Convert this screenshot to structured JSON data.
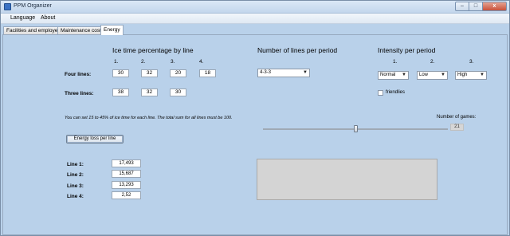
{
  "window": {
    "title": "PPM Organizer",
    "caption_buttons": {
      "minimize": "–",
      "maximize": "□",
      "close": "x"
    }
  },
  "menu": {
    "items": [
      {
        "label": "Language"
      },
      {
        "label": "About"
      }
    ]
  },
  "tabs": [
    {
      "label": "Facilities and employees",
      "active": false
    },
    {
      "label": "Maintenance costs",
      "active": false
    },
    {
      "label": "Energy",
      "active": true
    }
  ],
  "ice_time": {
    "heading": "Ice time percentage by line",
    "columns": [
      "1.",
      "2.",
      "3.",
      "4."
    ],
    "four_lines": {
      "label": "Four lines:",
      "values": [
        "30",
        "32",
        "20",
        "18"
      ]
    },
    "three_lines": {
      "label": "Three lines:",
      "values": [
        "38",
        "32",
        "30"
      ]
    },
    "info": "You can set 15 to 45% of ice time for each line.  The total sum for all lines must be 100."
  },
  "energy_button": {
    "label": "Energy loss per line"
  },
  "results": [
    {
      "label": "Line 1:",
      "value": "17,493"
    },
    {
      "label": "Line 2:",
      "value": "15,687"
    },
    {
      "label": "Line 3:",
      "value": "13,293"
    },
    {
      "label": "Line 4:",
      "value": "2,52"
    }
  ],
  "lines_per_period": {
    "heading": "Number of lines per period",
    "selected": "4-3-3",
    "arrow": "▼"
  },
  "intensity": {
    "heading": "Intensity per period",
    "columns": [
      "1.",
      "2.",
      "3."
    ],
    "values": [
      "Normal",
      "Low",
      "High"
    ],
    "arrow": "▼",
    "friendlies_label": "friendlies",
    "friendlies_checked": false
  },
  "games": {
    "label": "Number of games:",
    "value": "21",
    "slider_level": 0.5
  }
}
